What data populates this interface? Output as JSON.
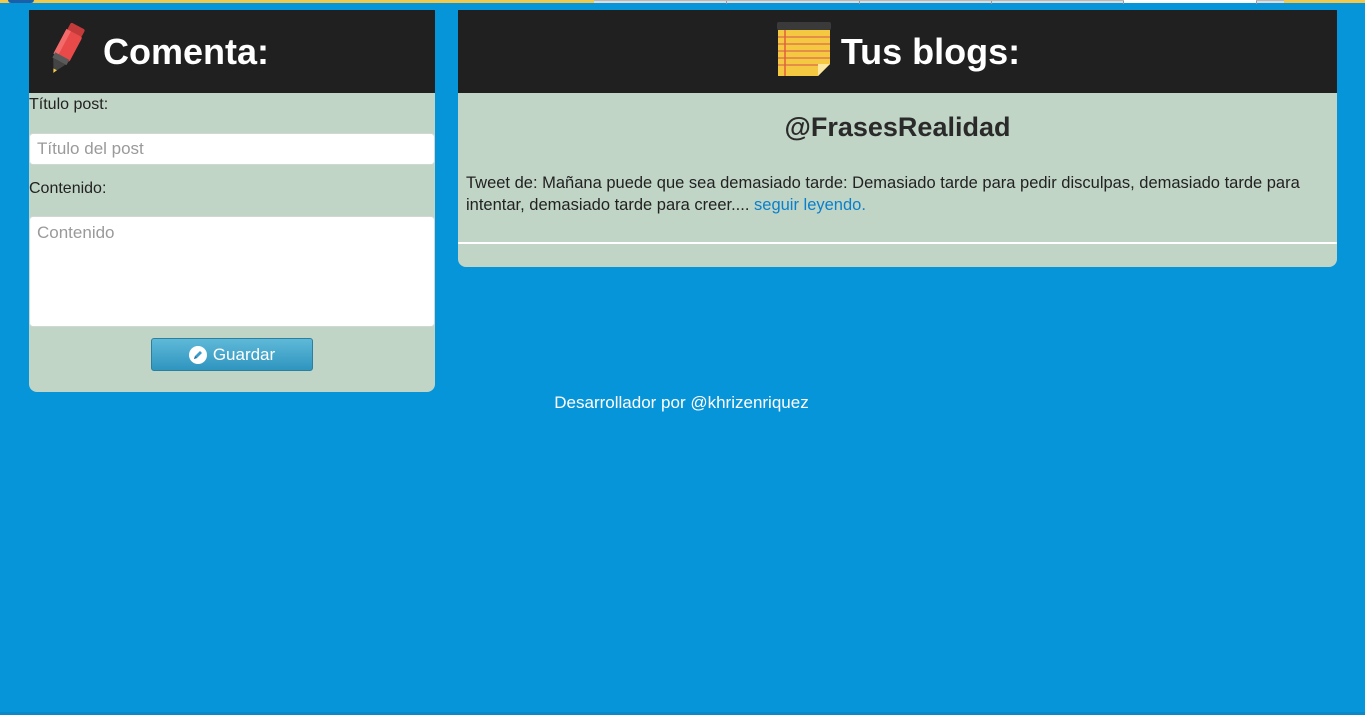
{
  "colors": {
    "background": "#0795d9",
    "panel_bg": "#c0d5c6",
    "panel_header": "#202020",
    "link": "#0a7fcb",
    "button": "#3da4cc"
  },
  "comment_form": {
    "icon": "marker-pen-icon",
    "heading": "Comenta:",
    "title_label": "Título post:",
    "title_placeholder": "Título del post",
    "title_value": "",
    "content_label": "Contenido:",
    "content_placeholder": "Contenido",
    "content_value": "",
    "save_icon": "pencil-icon",
    "save_label": "Guardar"
  },
  "blogs": {
    "icon": "notepad-icon",
    "heading": "Tus blogs:",
    "entries": [
      {
        "author": "@FrasesRealidad",
        "text": "Tweet de: Mañana puede que sea demasiado tarde: Demasiado tarde para pedir disculpas, demasiado tarde para intentar, demasiado tarde para creer.... ",
        "link_label": "seguir leyendo."
      }
    ]
  },
  "footer": {
    "credit": "Desarrollador por @khrizenriquez"
  }
}
